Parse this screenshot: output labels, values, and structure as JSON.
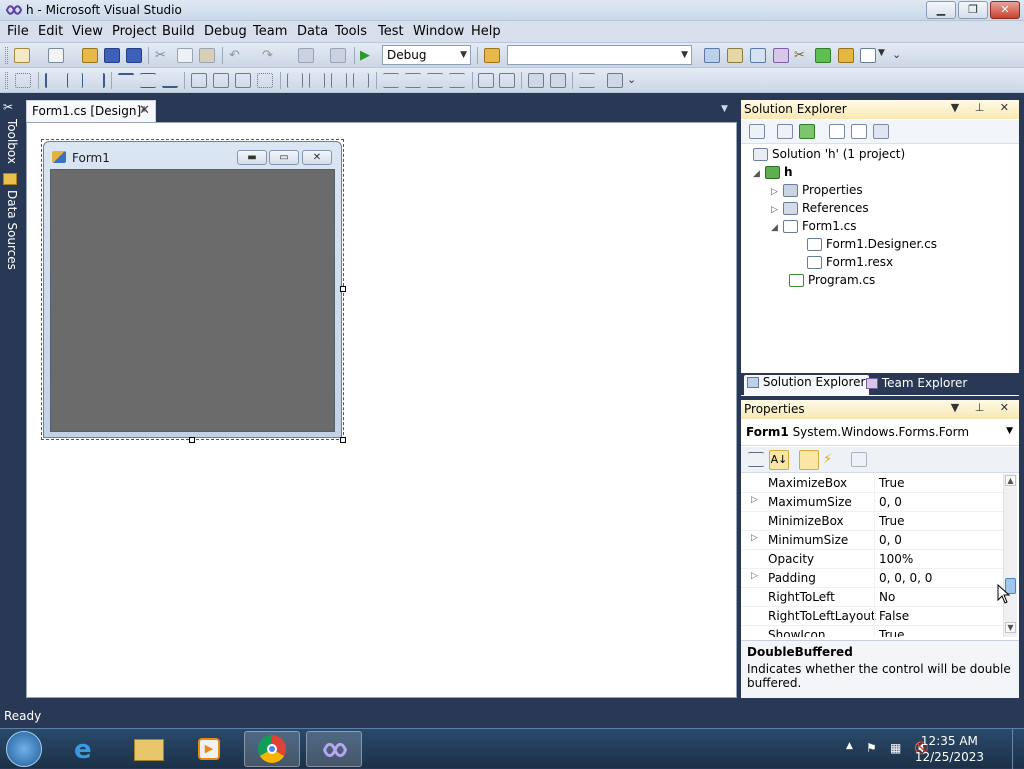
{
  "window": {
    "title": "h - Microsoft Visual Studio",
    "min": "▁",
    "max": "❐",
    "close": "✕"
  },
  "menu": [
    "File",
    "Edit",
    "View",
    "Project",
    "Build",
    "Debug",
    "Team",
    "Data",
    "Tools",
    "Test",
    "Window",
    "Help"
  ],
  "toolbar": {
    "config": "Debug",
    "platform": ""
  },
  "left_tabs": {
    "toolbox": "Toolbox",
    "data_sources": "Data Sources"
  },
  "document_tab": {
    "label": "Form1.cs [Design]*",
    "close": "✕"
  },
  "form": {
    "title": "Form1",
    "min": "▬",
    "max": "▭",
    "close": "✕"
  },
  "solution_explorer": {
    "title": "Solution Explorer",
    "buttons": "▼ ⊥ ✕",
    "items": [
      {
        "label": "Solution 'h' (1 project)",
        "icon": "solution-icon"
      },
      {
        "label": "h",
        "icon": "csharp-project-icon"
      },
      {
        "label": "Properties",
        "icon": "properties-folder-icon"
      },
      {
        "label": "References",
        "icon": "references-icon"
      },
      {
        "label": "Form1.cs",
        "icon": "form-file-icon"
      },
      {
        "label": "Form1.Designer.cs",
        "icon": "cs-file-icon"
      },
      {
        "label": "Form1.resx",
        "icon": "resx-file-icon"
      },
      {
        "label": "Program.cs",
        "icon": "cs-file-icon"
      }
    ],
    "tabs": [
      "Solution Explorer",
      "Team Explorer"
    ]
  },
  "properties": {
    "title": "Properties",
    "buttons": "▼ ⊥ ✕",
    "object_name": "Form1",
    "object_type": "System.Windows.Forms.Form",
    "rows": [
      {
        "name": "MaximizeBox",
        "value": "True",
        "expandable": false
      },
      {
        "name": "MaximumSize",
        "value": "0, 0",
        "expandable": true
      },
      {
        "name": "MinimizeBox",
        "value": "True",
        "expandable": false
      },
      {
        "name": "MinimumSize",
        "value": "0, 0",
        "expandable": true
      },
      {
        "name": "Opacity",
        "value": "100%",
        "expandable": false
      },
      {
        "name": "Padding",
        "value": "0, 0, 0, 0",
        "expandable": true
      },
      {
        "name": "RightToLeft",
        "value": "No",
        "expandable": false
      },
      {
        "name": "RightToLeftLayout",
        "value": "False",
        "expandable": false
      },
      {
        "name": "ShowIcon",
        "value": "True",
        "expandable": false
      }
    ],
    "description_title": "DoubleBuffered",
    "description_text": "Indicates whether the control will be double buffered."
  },
  "status": "Ready",
  "taskbar": {
    "time": "12:35 AM",
    "date": "12/25/2023"
  },
  "colors": {
    "ide_frame": "#293955",
    "panel_header": "#f8e8b2",
    "form_client": "#6b6b6b"
  }
}
